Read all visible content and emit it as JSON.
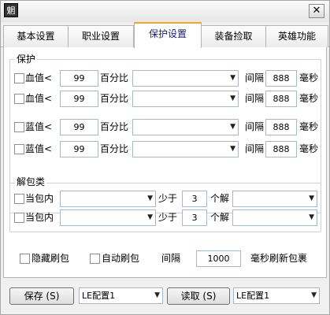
{
  "window": {
    "icon_glyph": "魍",
    "close_glyph": "✕"
  },
  "tabs": [
    "基本设置",
    "职业设置",
    "保护设置",
    "装备捡取",
    "英雄功能"
  ],
  "protect": {
    "title": "保护",
    "rows": [
      {
        "label": "血值<",
        "value": "99",
        "percent_label": "百分比",
        "combo_value": "",
        "interval_label": "间隔",
        "interval_value": "888",
        "unit": "毫秒"
      },
      {
        "label": "血值<",
        "value": "99",
        "percent_label": "百分比",
        "combo_value": "",
        "interval_label": "间隔",
        "interval_value": "888",
        "unit": "毫秒"
      },
      {
        "label": "蓝值<",
        "value": "99",
        "percent_label": "百分比",
        "combo_value": "",
        "interval_label": "间隔",
        "interval_value": "888",
        "unit": "毫秒"
      },
      {
        "label": "蓝值<",
        "value": "99",
        "percent_label": "百分比",
        "combo_value": "",
        "interval_label": "间隔",
        "interval_value": "888",
        "unit": "毫秒"
      }
    ]
  },
  "unpack": {
    "title": "解包类",
    "rows": [
      {
        "label": "当包内",
        "combo1": "",
        "less_label": "少于",
        "count": "3",
        "unit_label": "个解",
        "combo2": ""
      },
      {
        "label": "当包内",
        "combo1": "",
        "less_label": "少于",
        "count": "3",
        "unit_label": "个解",
        "combo2": ""
      }
    ]
  },
  "options": {
    "hide_label": "隐藏刷包",
    "auto_label": "自动刷包",
    "interval_label": "间隔",
    "interval_value": "1000",
    "suffix_label": "毫秒刷新包裹"
  },
  "footer": {
    "save_label": "保存 (S)",
    "save_config": "LE配置1",
    "read_label": "读取 (S)",
    "read_config": "LE配置1"
  },
  "colors": {
    "active_tab_accent": "#f5a623",
    "active_tab_text": "#1a1a80"
  }
}
